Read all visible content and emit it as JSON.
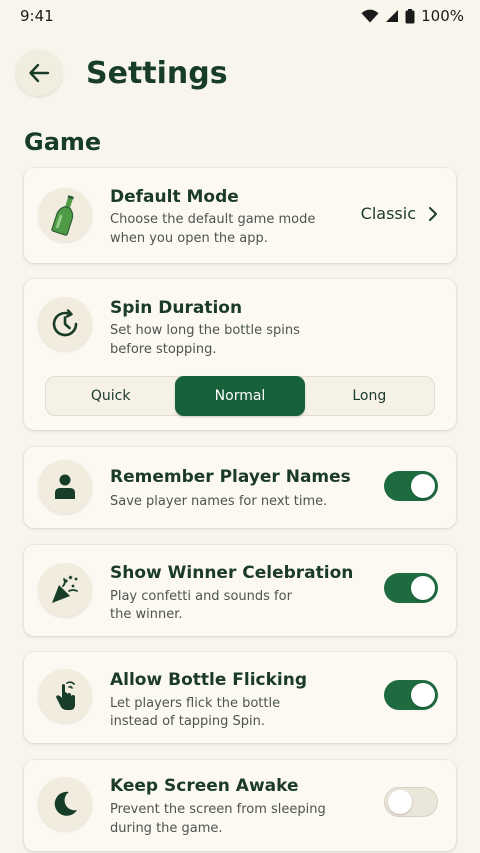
{
  "status": {
    "time": "9:41",
    "battery": "100%"
  },
  "header": {
    "title": "Settings"
  },
  "section": {
    "title": "Game"
  },
  "default_mode": {
    "title": "Default Mode",
    "desc_line1": "Choose the default game mode",
    "desc_line2": "when you open the app.",
    "value": "Classic"
  },
  "spin_duration": {
    "title": "Spin Duration",
    "desc_line1": "Set how long the bottle spins",
    "desc_line2": "before stopping.",
    "options": [
      "Quick",
      "Normal",
      "Long"
    ],
    "selected": "Normal"
  },
  "remember_names": {
    "title": "Remember Player Names",
    "desc_line1": "Save player names for next time.",
    "enabled": true
  },
  "winner_celebration": {
    "title": "Show Winner Celebration",
    "desc_line1": "Play confetti and sounds for",
    "desc_line2": "the winner.",
    "enabled": true
  },
  "bottle_flicking": {
    "title": "Allow Bottle Flicking",
    "desc_line1": "Let players flick the bottle",
    "desc_line2": "instead of tapping Spin.",
    "enabled": true
  },
  "screen_awake": {
    "title": "Keep Screen Awake",
    "desc_line1": "Prevent the screen from sleeping",
    "desc_line2": "during the game.",
    "enabled": false
  },
  "colors": {
    "accent": "#17603a",
    "background": "#f8f5ec",
    "title": "#173d29"
  }
}
